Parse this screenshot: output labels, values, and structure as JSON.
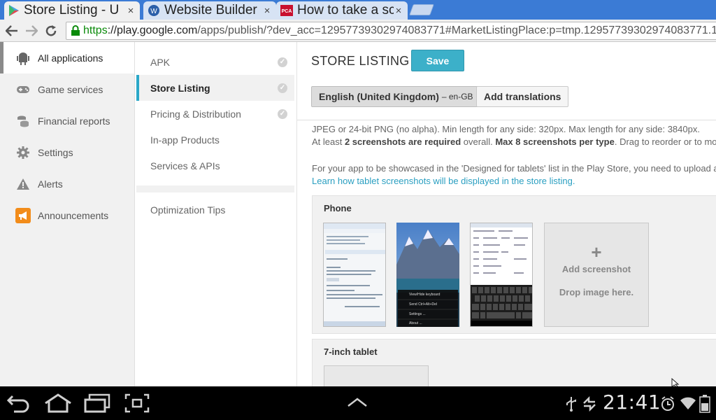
{
  "browser": {
    "tabs": [
      {
        "title": "Store Listing - U",
        "active": true,
        "close": "×"
      },
      {
        "title": "Website Builder",
        "active": false,
        "close": "×"
      },
      {
        "title": "How to take a sc",
        "active": false,
        "close": "×"
      }
    ],
    "url_https": "https",
    "url_host": "://play.google.com",
    "url_path": "/apps/publish/?dev_acc=12957739302974083771#MarketListingPlace:p=tmp.12957739302974083771.1"
  },
  "leftnav": {
    "items": [
      {
        "label": "All applications",
        "icon": "android-icon"
      },
      {
        "label": "Game services",
        "icon": "gamepad-icon"
      },
      {
        "label": "Financial reports",
        "icon": "coins-icon"
      },
      {
        "label": "Settings",
        "icon": "gear-icon"
      },
      {
        "label": "Alerts",
        "icon": "alert-icon"
      },
      {
        "label": "Announcements",
        "icon": "megaphone-icon"
      }
    ]
  },
  "midnav": {
    "items": [
      {
        "label": "APK",
        "checked": true
      },
      {
        "label": "Store Listing",
        "checked": true
      },
      {
        "label": "Pricing & Distribution",
        "checked": true
      },
      {
        "label": "In-app Products",
        "checked": false
      },
      {
        "label": "Services & APIs",
        "checked": false
      }
    ],
    "tips": "Optimization Tips"
  },
  "main": {
    "title": "STORE LISTING",
    "save": "Save",
    "language": "English (United Kingdom)",
    "language_code": "– en-GB",
    "add_translations": "Add translations",
    "line1": "JPEG or 24-bit PNG (no alpha). Min length for any side: 320px. Max length for any side: 3840px.",
    "line2_a": "At least ",
    "line2_b": "2 screenshots are required",
    "line2_c": " overall. ",
    "line2_d": "Max 8 screenshots per type",
    "line2_e": ". Drag to reorder or to mo",
    "line3": "For your app to be showcased in the 'Designed for tablets' list in the Play Store, you need to upload a",
    "line4_link": "Learn how tablet screenshots will be displayed in the store listing.",
    "phone_label": "Phone",
    "add_screenshot": "Add screenshot",
    "drop_image": "Drop image here.",
    "tablet_label": "7-inch tablet",
    "menu_items": [
      "View/Hide keyboard",
      "Send Ctrl+Alt+Del",
      "Settings ...",
      "About ..."
    ]
  },
  "system": {
    "clock": "21:41"
  },
  "colors": {
    "accent": "#3cb0c9",
    "tab_strip": "#3b7bd5",
    "link": "#2a9fc1"
  }
}
